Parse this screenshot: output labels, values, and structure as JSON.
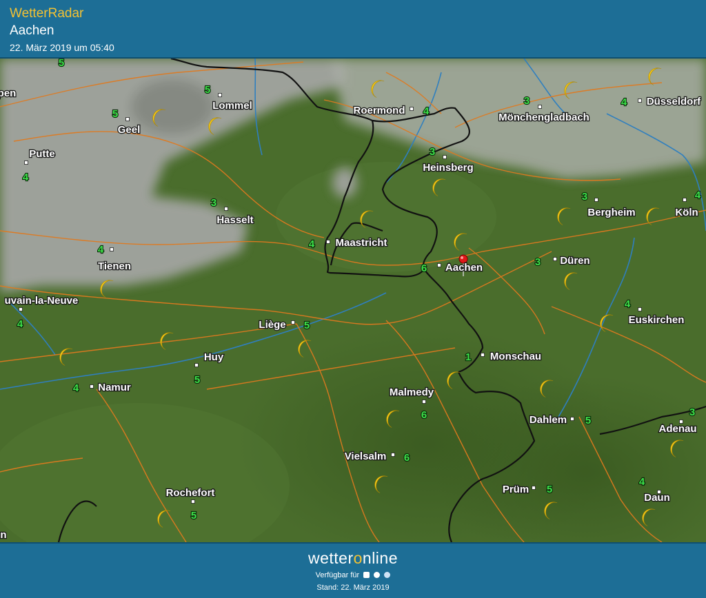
{
  "header": {
    "app_title": "WetterRadar",
    "city": "Aachen",
    "datetime": "22. März 2019 um 05:40"
  },
  "map": {
    "cities": [
      {
        "name": "Lommel",
        "temp": "5"
      },
      {
        "name": "Roermond",
        "temp": "4"
      },
      {
        "name": "Mönchengladbach",
        "temp": "3"
      },
      {
        "name": "Düsseldorf",
        "temp": "4"
      },
      {
        "name": "Geel",
        "temp": "5"
      },
      {
        "name": "Putte",
        "temp": "4"
      },
      {
        "name": "Heinsberg",
        "temp": "3"
      },
      {
        "name": "Hasselt",
        "temp": "3"
      },
      {
        "name": "Maastricht",
        "temp": "4"
      },
      {
        "name": "Bergheim",
        "temp": "3"
      },
      {
        "name": "Köln",
        "temp": "4"
      },
      {
        "name": "Tienen",
        "temp": "4"
      },
      {
        "name": "Aachen",
        "temp": "6"
      },
      {
        "name": "Düren",
        "temp": "3"
      },
      {
        "name": "uvain-la-Neuve",
        "temp": "4"
      },
      {
        "name": "Liège",
        "temp": "5"
      },
      {
        "name": "Euskirchen",
        "temp": "4"
      },
      {
        "name": "Huy",
        "temp": "5"
      },
      {
        "name": "Monschau",
        "temp": "1"
      },
      {
        "name": "Namur",
        "temp": "4"
      },
      {
        "name": "Malmedy",
        "temp": "6"
      },
      {
        "name": "Dahlem",
        "temp": "5"
      },
      {
        "name": "Adenau",
        "temp": "3"
      },
      {
        "name": "Vielsalm",
        "temp": "6"
      },
      {
        "name": "Rochefort",
        "temp": "5"
      },
      {
        "name": "Prüm",
        "temp": "5"
      },
      {
        "name": "Daun",
        "temp": "4"
      },
      {
        "name": "pen",
        "temp": ""
      },
      {
        "name": "n",
        "temp": ""
      }
    ],
    "extra_temps": [
      "5"
    ],
    "weather_icon": "crescent-moon-icon",
    "location_marker_icon": "map-pin-icon",
    "colors": {
      "land": "#47682a",
      "cloud": "#a8a8a8",
      "road": "#e07a1f",
      "river": "#2f7fbf",
      "border": "#111111",
      "moon": "#f3c81a",
      "temperature": "#3de04a"
    }
  },
  "footer": {
    "brand_prefix": "wetter",
    "brand_o": "o",
    "brand_suffix": "nline",
    "availability": "Verfügbar für",
    "stand": "Stand: 22. März 2019"
  }
}
